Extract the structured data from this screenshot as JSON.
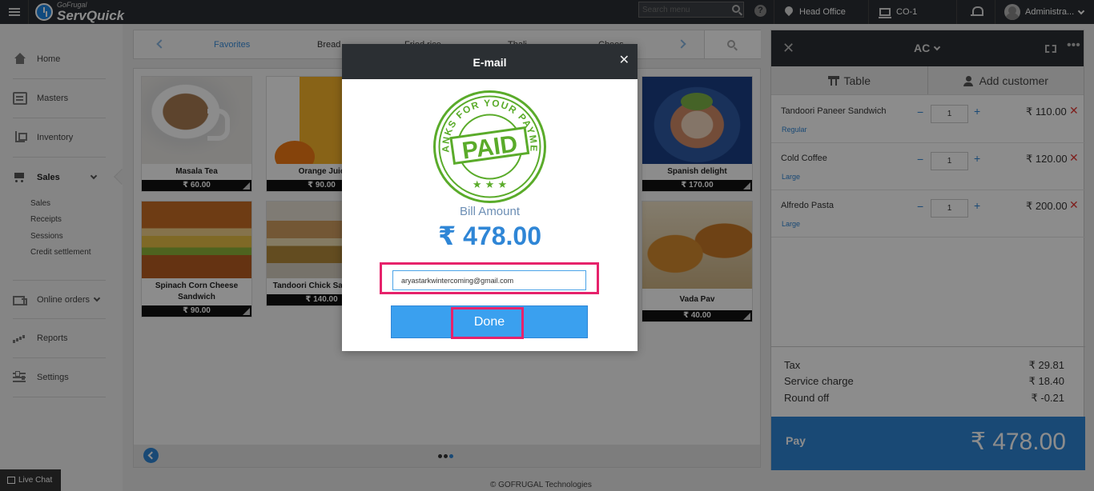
{
  "topbar": {
    "brand_small": "GoFrugal",
    "brand_name": "ServQuick",
    "search_placeholder": "Search menu",
    "help": "?",
    "location": "Head Office",
    "counter": "CO-1",
    "user": "Administra..."
  },
  "sidebar": {
    "items": [
      {
        "label": "Home",
        "icon": "home-icon"
      },
      {
        "label": "Masters",
        "icon": "box-icon"
      },
      {
        "label": "Inventory",
        "icon": "trolley-icon"
      },
      {
        "label": "Sales",
        "icon": "cart-icon"
      },
      {
        "label": "Online orders",
        "icon": "truck-icon"
      },
      {
        "label": "Reports",
        "icon": "bars-icon"
      },
      {
        "label": "Settings",
        "icon": "sliders-icon"
      }
    ],
    "sales_sub": [
      "Sales",
      "Receipts",
      "Sessions",
      "Credit settlement"
    ]
  },
  "categories": [
    "Favorites",
    "Bread",
    "Fried rice",
    "Thali",
    "Chees"
  ],
  "products": [
    {
      "name": "Masala Tea",
      "price": "₹ 60.00"
    },
    {
      "name": "Orange Juic",
      "price": "₹ 90.00"
    },
    {
      "name": "Spanish delight",
      "price": "₹ 170.00"
    },
    {
      "name": "Spinach Corn Cheese Sandwich",
      "price": "₹ 90.00"
    },
    {
      "name": "Tandoori Chick Sandwich",
      "price": "₹ 140.00"
    },
    {
      "name": "Vada Pav",
      "price": "₹ 40.00"
    }
  ],
  "order": {
    "section": "AC",
    "tabs": {
      "table": "Table",
      "customer": "Add customer"
    },
    "items": [
      {
        "name": "Tandoori Paneer Sandwich",
        "variant": "Regular",
        "qty": "1",
        "price": "₹ 110.00"
      },
      {
        "name": "Cold Coffee",
        "variant": "Large",
        "qty": "1",
        "price": "₹ 120.00"
      },
      {
        "name": "Alfredo Pasta",
        "variant": "Large",
        "qty": "1",
        "price": "₹ 200.00"
      }
    ],
    "totals": [
      {
        "label": "Tax",
        "value": "₹ 29.81"
      },
      {
        "label": "Service charge",
        "value": "₹ 18.40"
      },
      {
        "label": "Round off",
        "value": "₹ -0.21"
      }
    ],
    "pay_label": "Pay",
    "pay_amount": "₹ 478.00"
  },
  "modal": {
    "title": "E-mail",
    "stamp_text": "THANKS FOR YOUR PAYMENT",
    "stamp_main": "PAID",
    "bill_label": "Bill Amount",
    "bill_amount": "₹ 478.00",
    "email_value": "aryastarkwintercoming@gmail.com",
    "done_label": "Done"
  },
  "footer": "© GOFRUGAL Technologies",
  "live_chat": "Live Chat",
  "colors": {
    "accent": "#2f86d6",
    "highlight": "#e6226b",
    "stamp": "#5aab2a",
    "topbar": "#2b2f33"
  }
}
